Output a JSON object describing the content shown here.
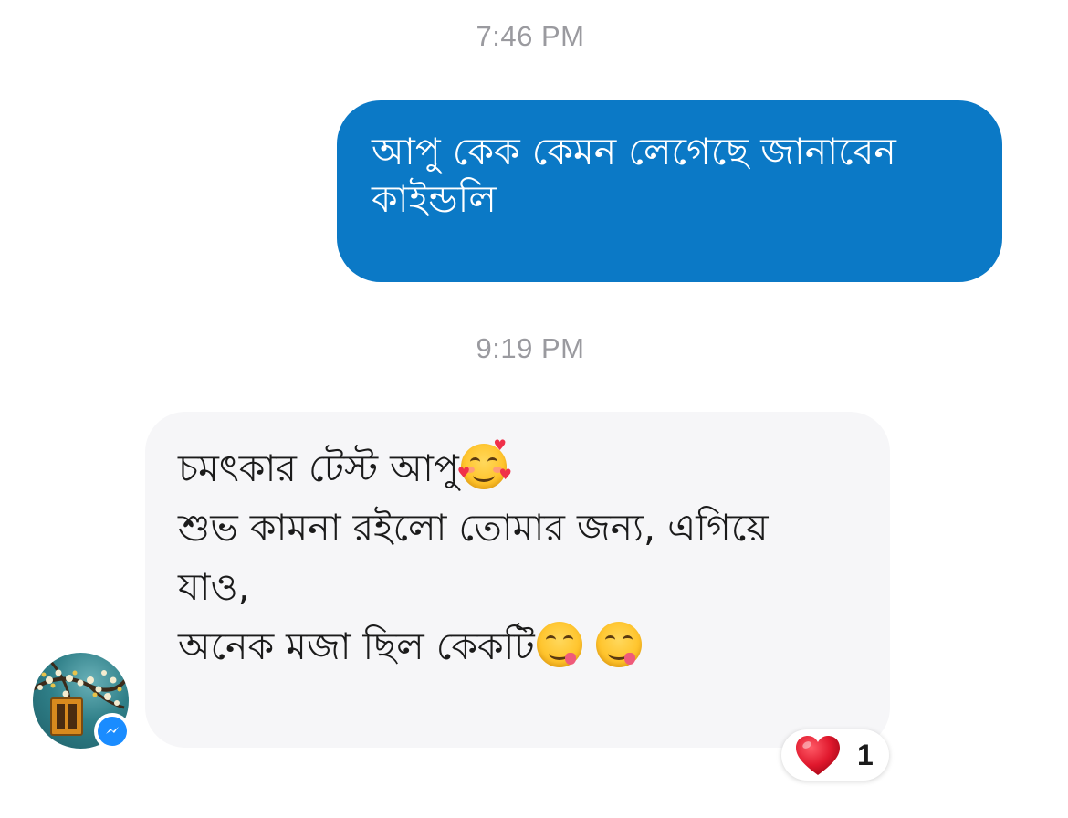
{
  "conversation": {
    "timestamps": [
      "7:46 PM",
      "9:19 PM"
    ],
    "outgoing_message": {
      "lines": [
        "আপু কেক কেমন লেগেছে জানাবেন",
        "কাইন্ডলি"
      ]
    },
    "incoming_message": {
      "lines": [
        "চমৎকার টেস্ট আপু",
        "শুভ কামনা রইলো তোমার জন্য, এগিয়ে",
        "যাও,",
        "অনেক মজা ছিল কেকটি"
      ],
      "emojis": [
        "smiling-face-with-hearts",
        "face-savoring-food",
        "face-savoring-food"
      ]
    },
    "reaction": {
      "emoji": "red-heart",
      "count": "1"
    },
    "avatar": {
      "badge": "messenger-icon"
    }
  },
  "colors": {
    "outgoing_bubble": "#0b79c6",
    "incoming_bubble": "#f6f6f8",
    "timestamp_text": "#9a9a9f",
    "messenger_badge": "#1a8cff",
    "heart": "#e0182d"
  }
}
